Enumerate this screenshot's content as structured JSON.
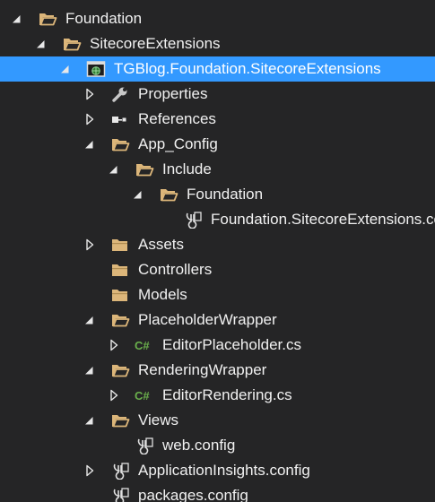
{
  "colors": {
    "background": "#252526",
    "selection": "#3399ff",
    "text": "#f1f1f1",
    "folder": "#dcb67a",
    "csharp": "#6ab04c",
    "wrench": "#c8c8c8",
    "expander": "#e8e8e8"
  },
  "tree": {
    "items": [
      {
        "label": "Foundation",
        "depth": 0,
        "state": "expanded",
        "icon": "folder-open-icon"
      },
      {
        "label": "SitecoreExtensions",
        "depth": 1,
        "state": "expanded",
        "icon": "folder-open-icon"
      },
      {
        "label": "TGBlog.Foundation.SitecoreExtensions",
        "depth": 2,
        "state": "expanded",
        "icon": "web-project-icon",
        "selected": true
      },
      {
        "label": "Properties",
        "depth": 3,
        "state": "collapsed",
        "icon": "wrench-icon"
      },
      {
        "label": "References",
        "depth": 3,
        "state": "collapsed",
        "icon": "references-icon"
      },
      {
        "label": "App_Config",
        "depth": 3,
        "state": "expanded",
        "icon": "folder-open-icon"
      },
      {
        "label": "Include",
        "depth": 4,
        "state": "expanded",
        "icon": "folder-open-icon"
      },
      {
        "label": "Foundation",
        "depth": 5,
        "state": "expanded",
        "icon": "folder-open-icon"
      },
      {
        "label": "Foundation.SitecoreExtensions.config",
        "depth": 6,
        "state": "none",
        "icon": "config-file-icon"
      },
      {
        "label": "Assets",
        "depth": 3,
        "state": "collapsed",
        "icon": "folder-closed-icon"
      },
      {
        "label": "Controllers",
        "depth": 3,
        "state": "none",
        "icon": "folder-closed-icon"
      },
      {
        "label": "Models",
        "depth": 3,
        "state": "none",
        "icon": "folder-closed-icon"
      },
      {
        "label": "PlaceholderWrapper",
        "depth": 3,
        "state": "expanded",
        "icon": "folder-open-icon"
      },
      {
        "label": "EditorPlaceholder.cs",
        "depth": 4,
        "state": "collapsed",
        "icon": "csharp-file-icon"
      },
      {
        "label": "RenderingWrapper",
        "depth": 3,
        "state": "expanded",
        "icon": "folder-open-icon"
      },
      {
        "label": "EditorRendering.cs",
        "depth": 4,
        "state": "collapsed",
        "icon": "csharp-file-icon"
      },
      {
        "label": "Views",
        "depth": 3,
        "state": "expanded",
        "icon": "folder-open-icon"
      },
      {
        "label": "web.config",
        "depth": 4,
        "state": "none",
        "icon": "config-file-icon"
      },
      {
        "label": "ApplicationInsights.config",
        "depth": 3,
        "state": "collapsed",
        "icon": "config-file-icon"
      },
      {
        "label": "packages.config",
        "depth": 3,
        "state": "none",
        "icon": "config-file-icon"
      }
    ]
  }
}
